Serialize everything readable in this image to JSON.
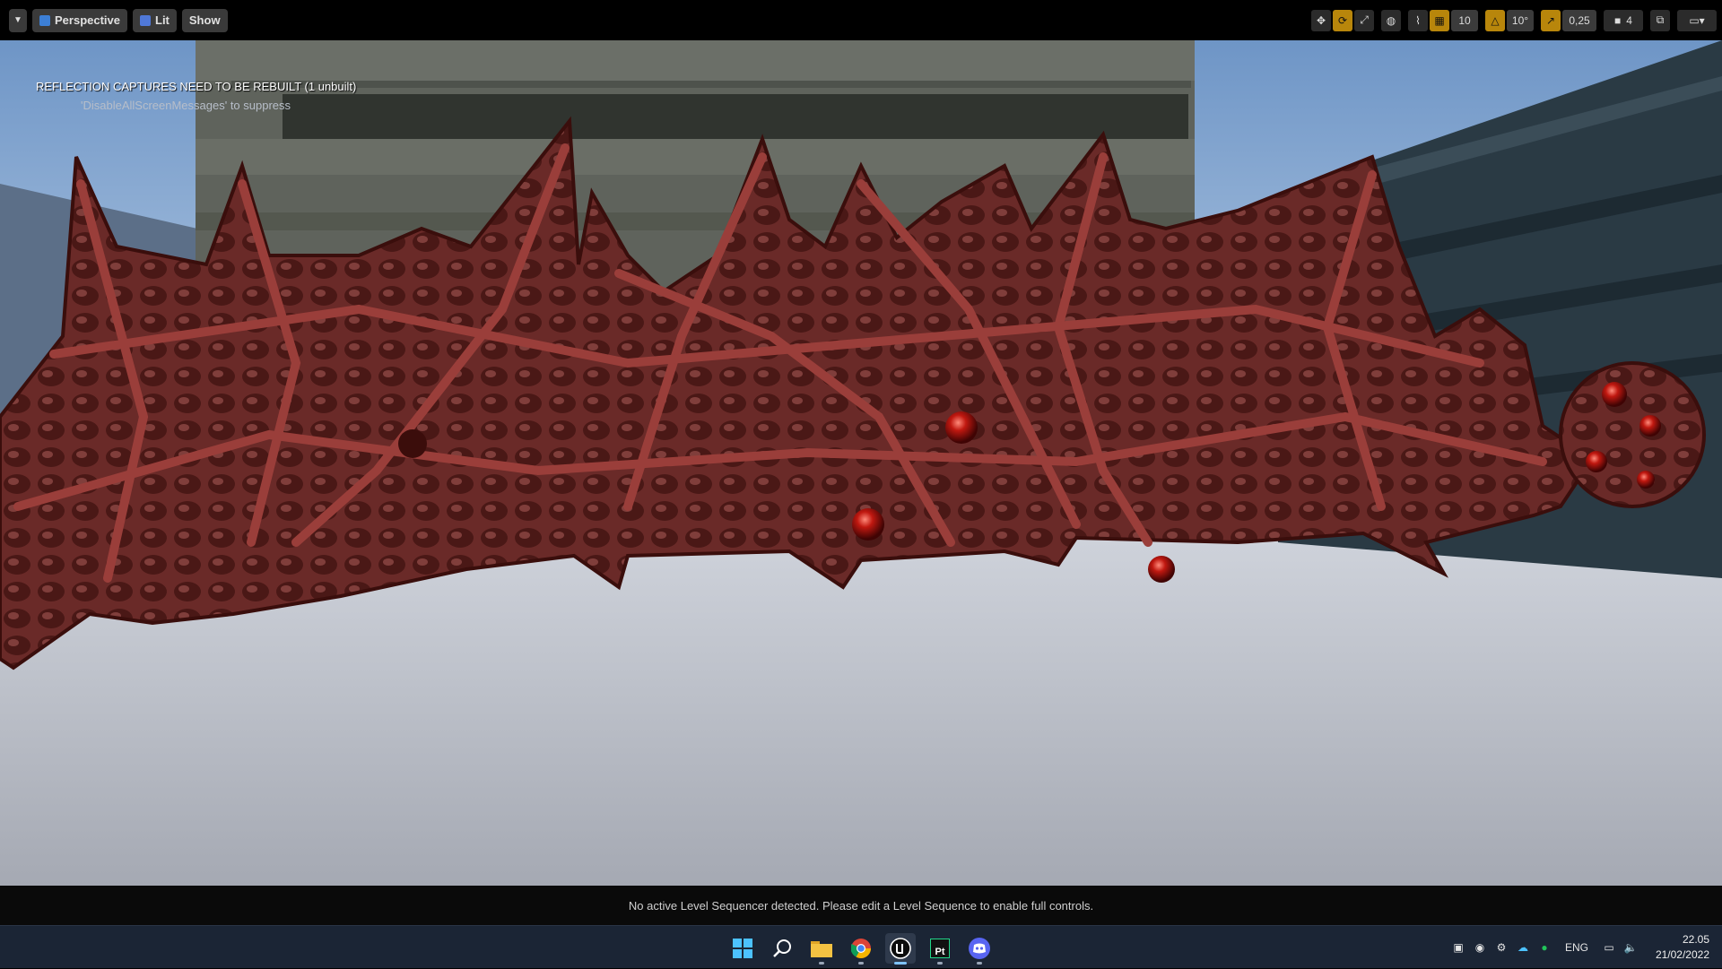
{
  "toolbar": {
    "perspective_label": "Perspective",
    "lit_label": "Lit",
    "show_label": "Show",
    "grid_snap_value": "10",
    "rotation_snap_value": "10°",
    "scale_snap_value": "0,25",
    "camera_speed_value": "4"
  },
  "viewport": {
    "notice": "REFLECTION CAPTURES NEED TO BE REBUILT (1 unbuilt)",
    "hint": "'DisableAllScreenMessages' to suppress"
  },
  "sequencer": {
    "message": "No active Level Sequencer detected. Please edit a Level Sequence to enable full controls."
  },
  "taskbar": {
    "apps": [
      "start-icon",
      "search-icon",
      "file-explorer-icon",
      "chrome-icon",
      "unreal-engine-icon",
      "pycharm-icon",
      "discord-icon"
    ],
    "pycharm_label": "Pt",
    "language": "ENG",
    "time": "22.05",
    "date": "21/02/2022"
  },
  "colors": {
    "accent_orange": "#b8860b",
    "taskbar_bg": "#1b2535",
    "flesh": "#8a3a36"
  }
}
